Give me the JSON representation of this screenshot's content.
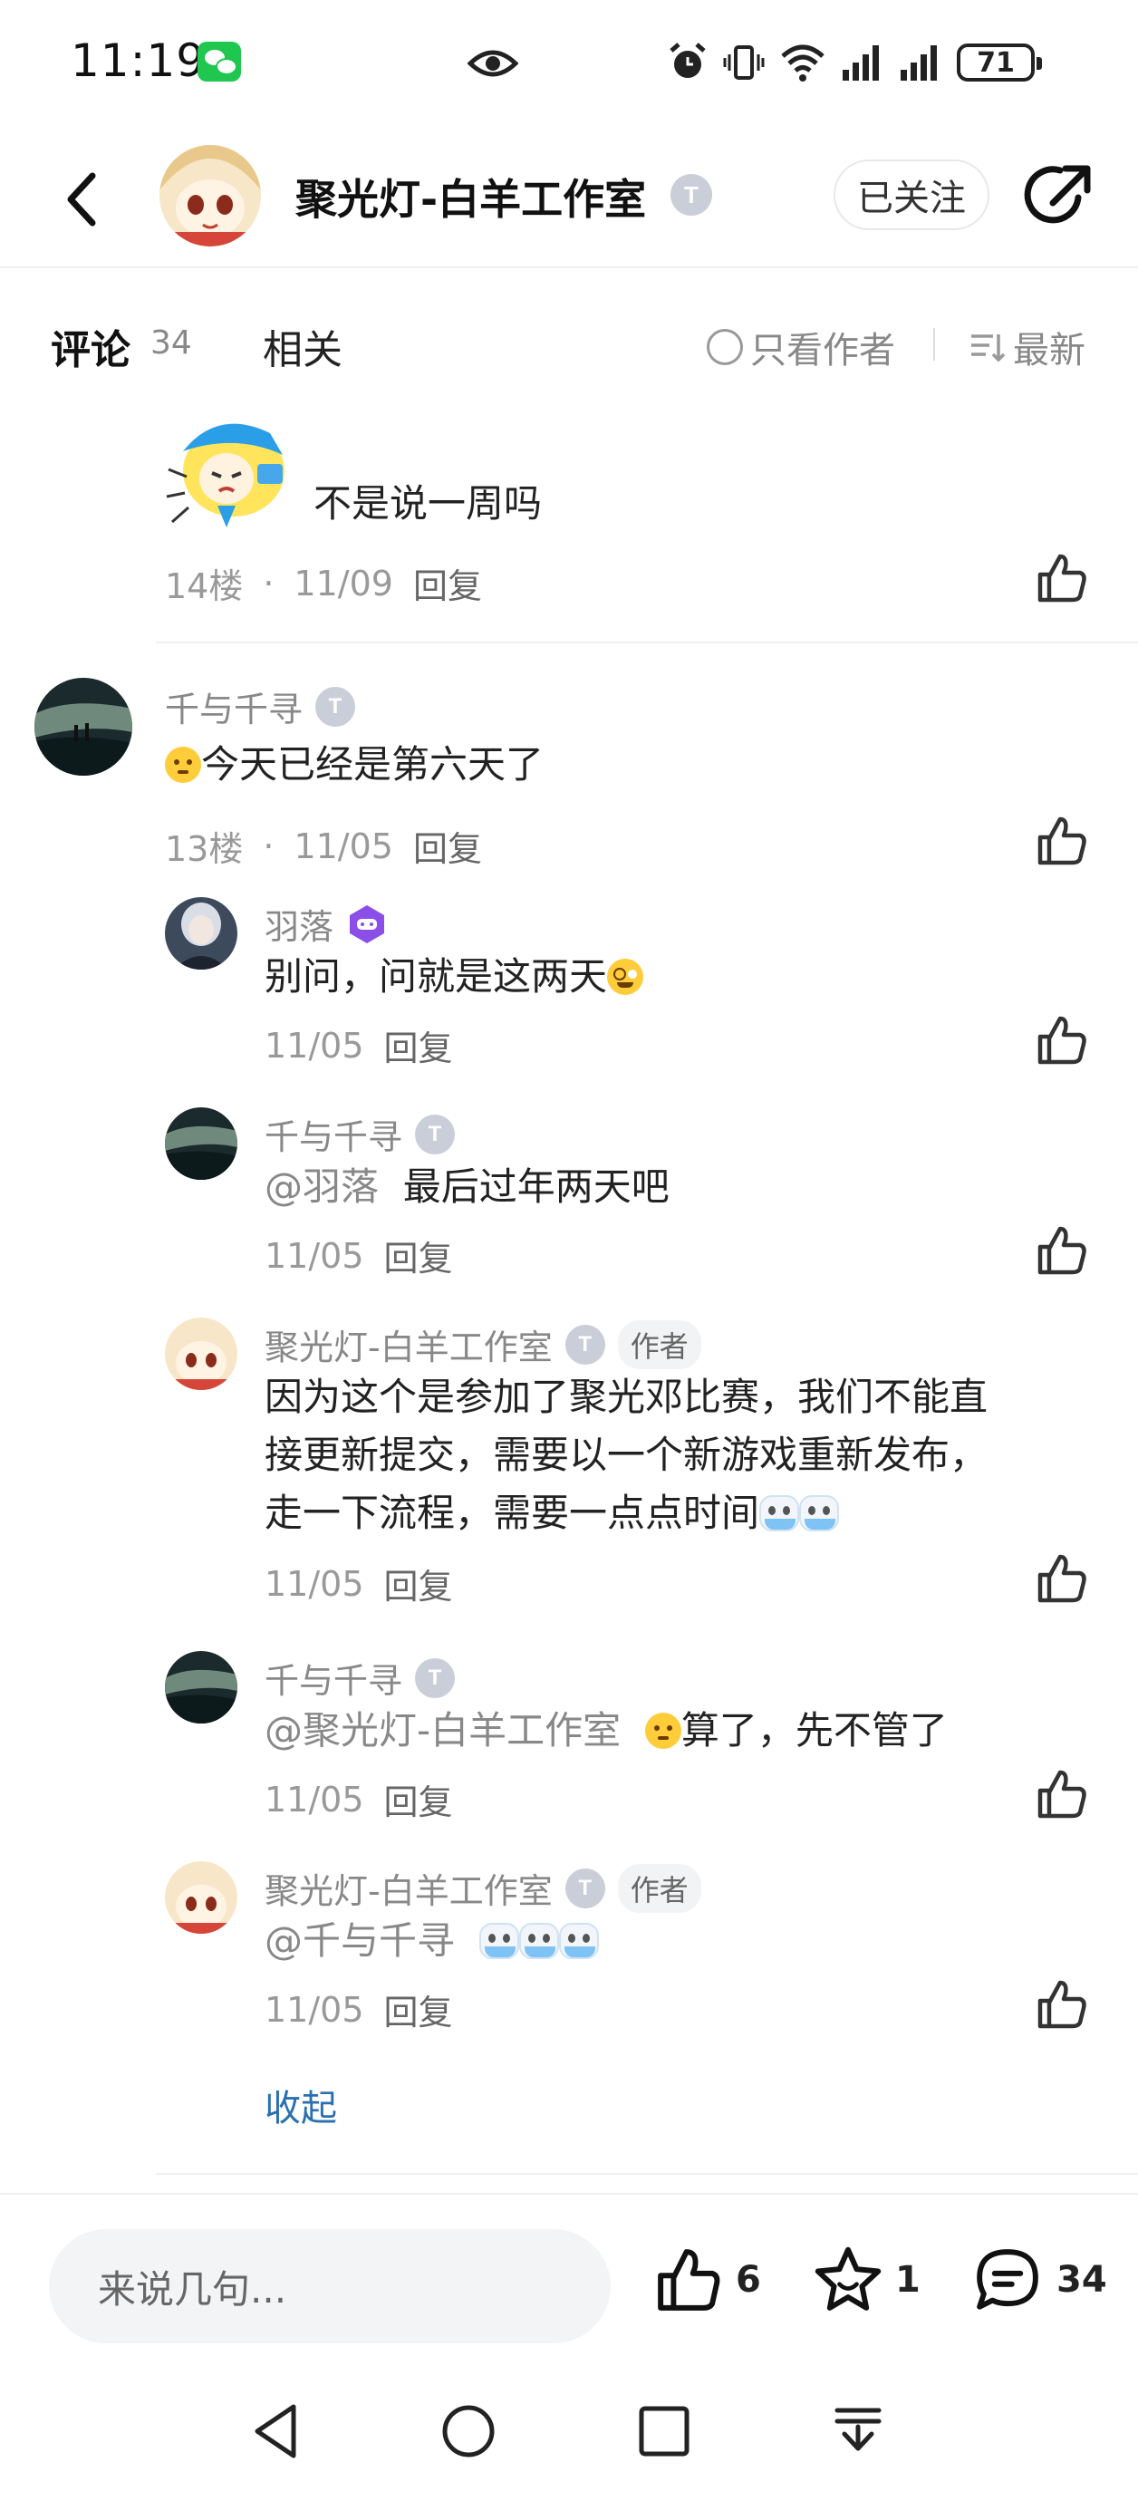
{
  "status_bar": {
    "time": "11:19",
    "battery": "71"
  },
  "header": {
    "back_icon": "chevron-left-icon",
    "title": "聚光灯-白羊工作室",
    "follow_label": "已关注",
    "share_icon": "share-icon"
  },
  "tabs": {
    "comments_label": "评论",
    "comments_count": "34",
    "related_label": "相关",
    "author_only_label": "只看作者",
    "sort_label": "最新"
  },
  "comments": [
    {
      "text": "不是说一周吗",
      "floor": "14楼",
      "date": "11/09",
      "reply_label": "回复"
    },
    {
      "user": "千与千寻",
      "text": "今天已经是第六天了",
      "floor": "13楼",
      "date": "11/05",
      "reply_label": "回复",
      "replies": [
        {
          "user": "羽落",
          "text": "别问，问就是这两天",
          "date": "11/05",
          "reply_label": "回复"
        },
        {
          "user": "千与千寻",
          "mention": "@羽落",
          "text": "最后过年两天吧",
          "date": "11/05",
          "reply_label": "回复"
        },
        {
          "user": "聚光灯-白羊工作室",
          "author_tag": "作者",
          "text_lines": [
            "因为这个是参加了聚光邓比赛，我们不能直",
            "接更新提交，需要以一个新游戏重新发布，",
            "走一下流程，需要一点点时间"
          ],
          "date": "11/05",
          "reply_label": "回复"
        },
        {
          "user": "千与千寻",
          "mention": "@聚光灯-白羊工作室",
          "text": "算了，先不管了",
          "date": "11/05",
          "reply_label": "回复"
        },
        {
          "user": "聚光灯-白羊工作室",
          "author_tag": "作者",
          "mention": "@千与千寻",
          "date": "11/05",
          "reply_label": "回复"
        }
      ],
      "collapse_label": "收起"
    }
  ],
  "bottom_bar": {
    "input_placeholder": "来说几句...",
    "likes": "6",
    "favorites": "1",
    "comments": "34"
  },
  "colors": {
    "accent": "#2fd6cc",
    "link": "#2a6fb0",
    "badge": "#c9ced8",
    "muted_text": "#888888"
  }
}
